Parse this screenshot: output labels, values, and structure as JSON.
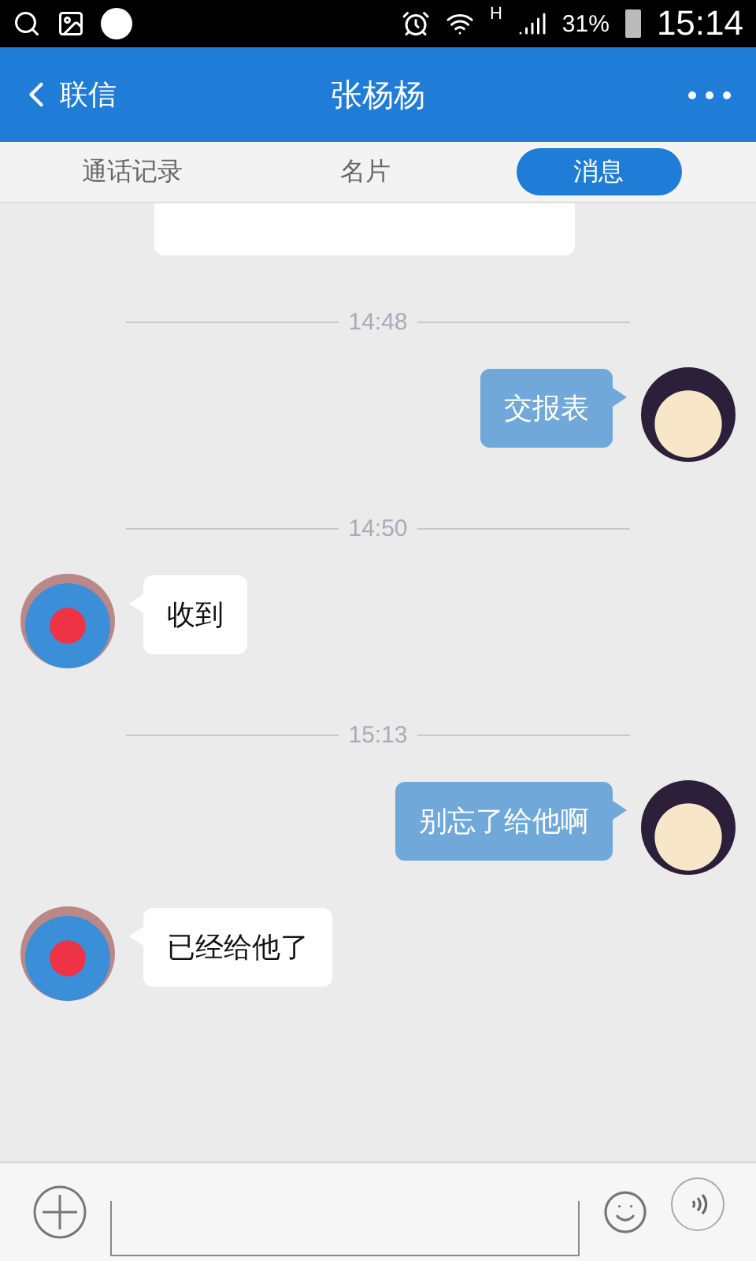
{
  "status_bar": {
    "network": "H",
    "battery": "31%",
    "time": "15:14"
  },
  "header": {
    "back": "联信",
    "title": "张杨杨"
  },
  "tabs": [
    {
      "label": "通话记录",
      "selected": false
    },
    {
      "label": "名片",
      "selected": false
    },
    {
      "label": "消息",
      "selected": true
    }
  ],
  "messages": [
    {
      "kind": "time",
      "text": "14:48"
    },
    {
      "kind": "out",
      "text": "交报表"
    },
    {
      "kind": "time",
      "text": "14:50"
    },
    {
      "kind": "in",
      "text": "收到"
    },
    {
      "kind": "time",
      "text": "15:13"
    },
    {
      "kind": "out",
      "text": "别忘了给他啊"
    },
    {
      "kind": "in",
      "text": "已经给他了"
    }
  ]
}
